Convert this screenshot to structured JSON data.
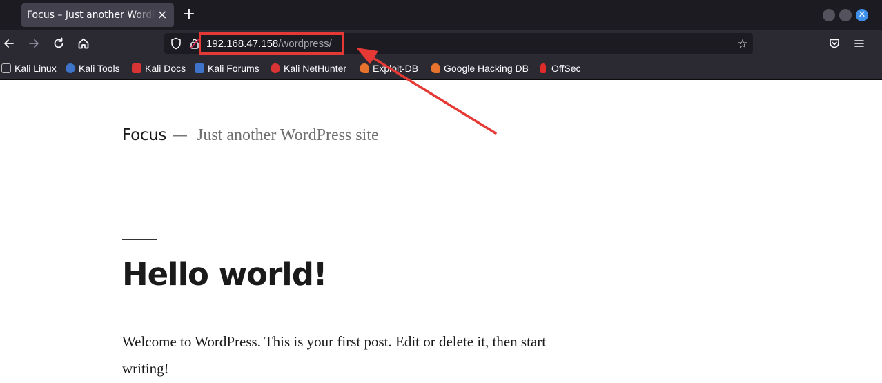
{
  "browser": {
    "tab": {
      "title": "Focus – Just another WordPress site",
      "close_icon": "close-icon"
    },
    "new_tab_icon": "plus-icon",
    "window_controls": [
      "minimize-icon",
      "maximize-icon",
      "close-icon"
    ],
    "address": {
      "host": "192.168.47.158",
      "path": "/wordpress/"
    },
    "bookmarks": [
      {
        "label": "Kali Linux",
        "icon": "kali-dragon-icon",
        "color": "#ffffff"
      },
      {
        "label": "Kali Tools",
        "icon": "kali-tools-icon",
        "color": "#3d73c8"
      },
      {
        "label": "Kali Docs",
        "icon": "kali-docs-icon",
        "color": "#d73435"
      },
      {
        "label": "Kali Forums",
        "icon": "kali-forums-icon",
        "color": "#3d73c8"
      },
      {
        "label": "Kali NetHunter",
        "icon": "kali-nethunter-icon",
        "color": "#d73435"
      },
      {
        "label": "Exploit-DB",
        "icon": "exploit-db-icon",
        "color": "#e8732f"
      },
      {
        "label": "Google Hacking DB",
        "icon": "ghdb-icon",
        "color": "#e8732f"
      },
      {
        "label": "OffSec",
        "icon": "offsec-icon",
        "color": "#e02b2b"
      }
    ]
  },
  "page": {
    "site_title": "Focus",
    "separator": "—",
    "site_description": "Just another WordPress site",
    "post": {
      "title": "Hello world!",
      "body": "Welcome to WordPress. This is your first post. Edit or delete it, then start writing!"
    }
  },
  "annotation": {
    "color": "#e53935"
  }
}
